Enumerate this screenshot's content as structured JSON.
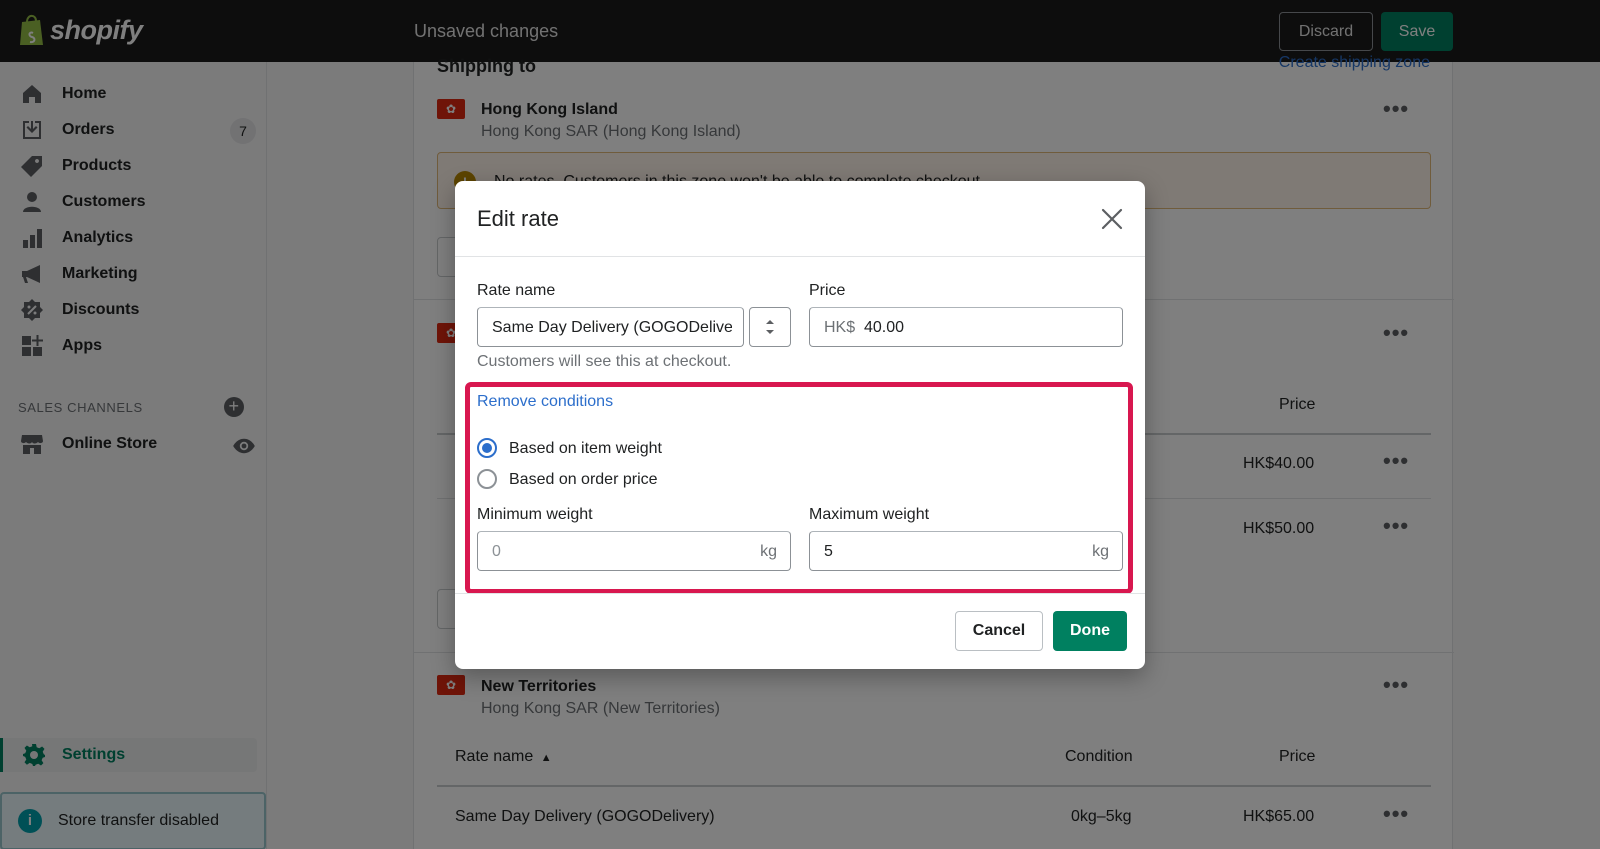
{
  "topbar": {
    "logo_text": "shopify",
    "status": "Unsaved changes",
    "discard_label": "Discard",
    "save_label": "Save"
  },
  "sidebar": {
    "items": [
      {
        "label": "Home",
        "icon": "home-icon"
      },
      {
        "label": "Orders",
        "icon": "orders-icon",
        "badge": "7"
      },
      {
        "label": "Products",
        "icon": "tag-icon"
      },
      {
        "label": "Customers",
        "icon": "person-icon"
      },
      {
        "label": "Analytics",
        "icon": "bar-chart-icon"
      },
      {
        "label": "Marketing",
        "icon": "megaphone-icon"
      },
      {
        "label": "Discounts",
        "icon": "discount-icon"
      },
      {
        "label": "Apps",
        "icon": "apps-icon"
      }
    ],
    "sales_channels_heading": "SALES CHANNELS",
    "online_store_label": "Online Store",
    "settings_label": "Settings",
    "store_transfer_label": "Store transfer disabled"
  },
  "main": {
    "section_title": "Shipping to",
    "create_zone_link": "Create shipping zone",
    "zone1": {
      "title": "Hong Kong Island",
      "subtitle": "Hong Kong SAR (Hong Kong Island)",
      "warning": "No rates. Customers in this zone won't be able to complete checkout."
    },
    "zone2": {
      "price_header": "Price",
      "prices": [
        "HK$40.00",
        "HK$50.00"
      ]
    },
    "zone3": {
      "title": "New Territories",
      "subtitle": "Hong Kong SAR (New Territories)",
      "headers": {
        "rate_name": "Rate name",
        "condition": "Condition",
        "price": "Price"
      },
      "rows": [
        {
          "name": "Same Day Delivery (GOGODelivery)",
          "condition": "0kg–5kg",
          "price": "HK$65.00"
        }
      ]
    }
  },
  "modal": {
    "title": "Edit rate",
    "rate_name_label": "Rate name",
    "rate_name_value": "Same Day Delivery (GOGODelivery)",
    "price_label": "Price",
    "price_prefix": "HK$",
    "price_value": "40.00",
    "hint": "Customers will see this at checkout.",
    "remove_conditions": "Remove conditions",
    "radio_weight": "Based on item weight",
    "radio_price": "Based on order price",
    "min_weight_label": "Minimum weight",
    "min_weight_placeholder": "0",
    "max_weight_label": "Maximum weight",
    "max_weight_value": "5",
    "unit": "kg",
    "cancel_label": "Cancel",
    "done_label": "Done"
  },
  "colors": {
    "primary": "#008060",
    "link": "#2c6ecb",
    "highlight": "#d8174f"
  }
}
